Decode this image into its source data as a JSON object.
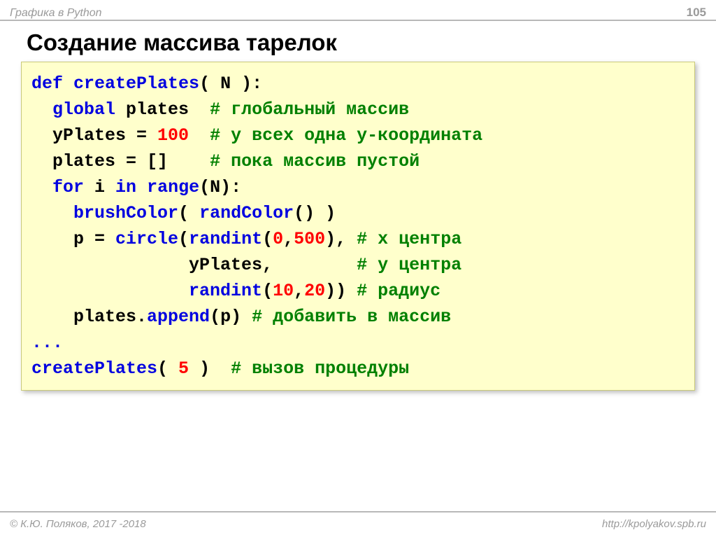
{
  "header": {
    "breadcrumb": "Графика в Python",
    "page": "105"
  },
  "title": "Создание массива тарелок",
  "code": {
    "l1": {
      "kw1": "def",
      "fn": "createPlates",
      "args": "( N ):"
    },
    "l2": {
      "kw": "global",
      "var": " plates  ",
      "cmt": "# глобальный массив"
    },
    "l3": {
      "txt": "yPlates = ",
      "num": "100",
      "pad": "  ",
      "cmt": "# у всех одна y-координата"
    },
    "l4": {
      "txt": "plates = []    ",
      "cmt": "# пока массив пустой"
    },
    "l5": {
      "kw1": "for",
      "mid": " i ",
      "kw2": "in",
      "sp": " ",
      "fn": "range",
      "tail": "(N):"
    },
    "l6": {
      "fn": "brushColor",
      "txt1": "( ",
      "fn2": "randColor",
      "txt2": "() )"
    },
    "l7": {
      "txt1": "p = ",
      "fn1": "circle",
      "txt2": "(",
      "fn2": "randint",
      "txt3": "(",
      "n1": "0",
      "c": ",",
      "n2": "500",
      "txt4": "), ",
      "cmt": "# x центра"
    },
    "l8": {
      "pad": "           yPlates,        ",
      "cmt": "# y центра"
    },
    "l9": {
      "pad": "           ",
      "fn": "randint",
      "t1": "(",
      "n1": "10",
      "c": ",",
      "n2": "20",
      "t2": ")) ",
      "cmt": "# радиус"
    },
    "l10": {
      "txt1": "plates.",
      "fn": "append",
      "txt2": "(p) ",
      "cmt": "# добавить в массив"
    },
    "l11": {
      "dots": "..."
    },
    "l12": {
      "fn": "createPlates",
      "t1": "( ",
      "num": "5",
      "t2": " )  ",
      "cmt": "# вызов процедуры"
    }
  },
  "footer": {
    "copyright": "© К.Ю. Поляков, 2017 -2018",
    "url": "http://kpolyakov.spb.ru"
  }
}
